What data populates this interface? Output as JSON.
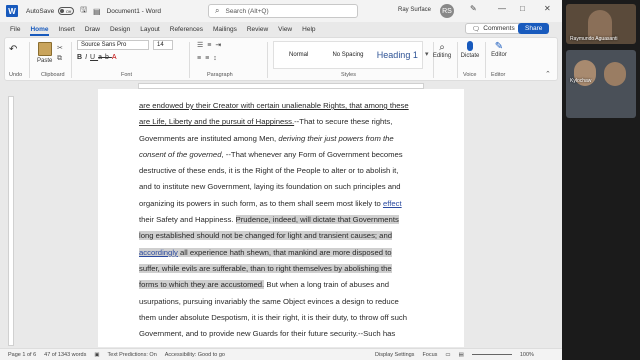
{
  "titlebar": {
    "autosave_label": "AutoSave",
    "autosave_state": "Off",
    "document_title": "Document1 - Word",
    "search_placeholder": "Search (Alt+Q)",
    "user_name": "Ray Surface",
    "avatar_initials": "RS"
  },
  "menu": {
    "tabs": [
      "File",
      "Home",
      "Insert",
      "Draw",
      "Design",
      "Layout",
      "References",
      "Mailings",
      "Review",
      "View",
      "Help"
    ],
    "active_tab": "Home",
    "comments_label": "Comments",
    "share_label": "Share"
  },
  "ribbon": {
    "paste_label": "Paste",
    "undo_label": "Undo",
    "clipboard_label": "Clipboard",
    "font_name": "Source Sans Pro",
    "font_size": "14",
    "font_label": "Font",
    "paragraph_label": "Paragraph",
    "styles": [
      "Normal",
      "No Spacing",
      "Heading 1"
    ],
    "styles_label": "Styles",
    "editing_label": "Editing",
    "dictate_label": "Dictate",
    "voice_label": "Voice",
    "editor_label": "Editor",
    "editor_group_label": "Editor"
  },
  "document": {
    "lines": [
      [
        {
          "t": "are endowed by their Creator with certain unalienable Rights, that among these",
          "s": "ul"
        }
      ],
      [
        {
          "t": "are Life, Liberty and the pursuit of Happiness.",
          "s": "ul"
        },
        {
          "t": "--That to secure these rights,",
          "s": ""
        }
      ],
      [
        {
          "t": "Governments are instituted among Men, ",
          "s": ""
        },
        {
          "t": "deriving their just powers from the",
          "s": "it"
        }
      ],
      [
        {
          "t": "consent of the governed",
          "s": "it"
        },
        {
          "t": ", --That whenever any Form of Government becomes",
          "s": ""
        }
      ],
      [
        {
          "t": "destructive of these ends, it is the Right of the People to alter or to abolish it,",
          "s": ""
        }
      ],
      [
        {
          "t": "and to institute new Government, laying its foundation on such principles and",
          "s": ""
        }
      ],
      [
        {
          "t": "organizing its powers in such form, as to them shall seem most likely to ",
          "s": ""
        },
        {
          "t": "effect",
          "s": "link"
        }
      ],
      [
        {
          "t": "their Safety and Happiness. ",
          "s": ""
        },
        {
          "t": "Prudence, indeed, will dictate that Governments",
          "s": "hl"
        }
      ],
      [
        {
          "t": "long established should not be changed for light and transient causes; and",
          "s": "hl"
        }
      ],
      [
        {
          "t": "accordingly",
          "s": "hl link"
        },
        {
          "t": " all experience hath shewn, that mankind are more disposed to",
          "s": "hl"
        }
      ],
      [
        {
          "t": "suffer, while evils are sufferable, than to right themselves by abolishing the",
          "s": "hl"
        }
      ],
      [
        {
          "t": "forms to which they are accustomed.",
          "s": "hl"
        },
        {
          "t": " But when a long train of abuses and",
          "s": ""
        }
      ],
      [
        {
          "t": "usurpations, pursuing invariably the same Object evinces a design to reduce",
          "s": ""
        }
      ],
      [
        {
          "t": "them under absolute Despotism, it is their right, it is their duty, to throw off such",
          "s": ""
        }
      ],
      [
        {
          "t": "Government, and to provide new Guards for their future security.--Such has",
          "s": ""
        }
      ]
    ]
  },
  "status": {
    "page": "Page 1 of 6",
    "words": "47 of 1343 words",
    "predictions": "Text Predictions: On",
    "accessibility": "Accessibility: Good to go",
    "display": "Display Settings",
    "focus": "Focus",
    "zoom": "100%"
  },
  "participants": [
    {
      "name": "Raymundo Aguasanti",
      "color": "#5a4a3a"
    },
    {
      "name": "Kylochaw",
      "color": "#4a5058"
    },
    {
      "name": "",
      "color": "#3c3d40"
    }
  ]
}
